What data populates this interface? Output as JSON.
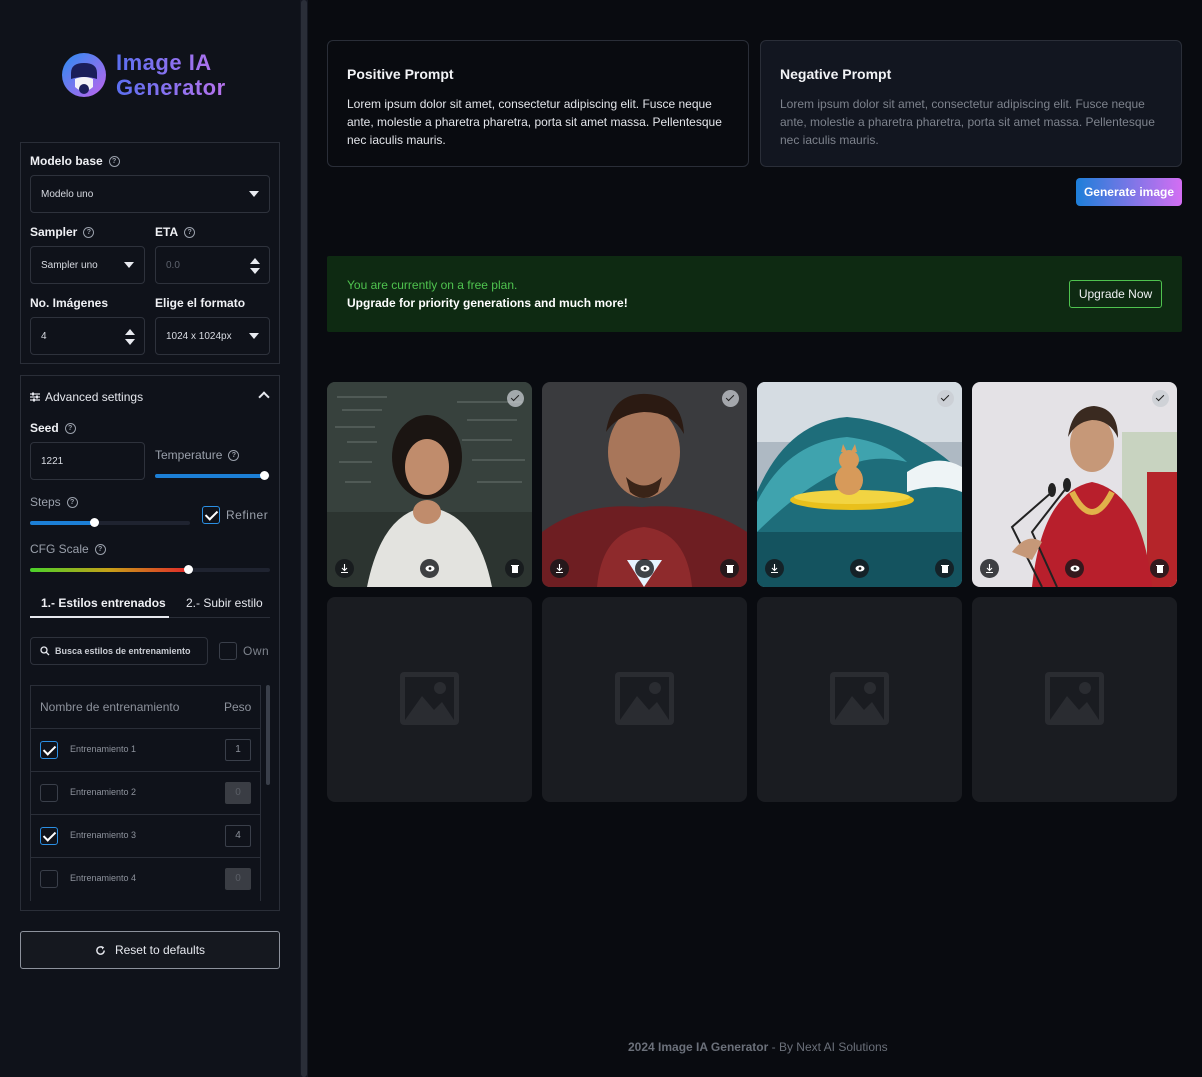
{
  "app": {
    "logo_line1": "Image IA",
    "logo_line2": "Generator"
  },
  "settings": {
    "base_model_label": "Modelo base",
    "base_model_value": "Modelo uno",
    "sampler_label": "Sampler",
    "sampler_value": "Sampler uno",
    "eta_label": "ETA",
    "eta_placeholder": "0.0",
    "num_images_label": "No. Imágenes",
    "num_images_value": "4",
    "format_label": "Elige el formato",
    "format_value": "1024 x 1024px"
  },
  "advanced": {
    "title": "Advanced settings",
    "seed_label": "Seed",
    "seed_value": "1221",
    "temperature_label": "Temperature",
    "temperature_level": 0.95,
    "steps_label": "Steps",
    "steps_level": 0.4,
    "refiner_label": "Refiner",
    "refiner_checked": true,
    "cfg_label": "CFG Scale",
    "cfg_level": 0.66
  },
  "styles": {
    "tab_trained": "1.- Estilos entrenados",
    "tab_upload": "2.- Subir estilo",
    "search_placeholder": "Busca estilos de entrenamiento",
    "own_label": "Own",
    "col_name": "Nombre de entrenamiento",
    "col_weight": "Peso",
    "rows": [
      {
        "name": "Entrenamiento 1",
        "weight": "1",
        "checked": true
      },
      {
        "name": "Entrenamiento 2",
        "weight": "0",
        "checked": false
      },
      {
        "name": "Entrenamiento 3",
        "weight": "4",
        "checked": true
      },
      {
        "name": "Entrenamiento 4",
        "weight": "0",
        "checked": false
      }
    ]
  },
  "reset_label": "Reset to defaults",
  "prompts": {
    "positive_title": "Positive Prompt",
    "positive_text": "Lorem ipsum dolor sit amet, consectetur adipiscing elit. Fusce neque ante, molestie a pharetra pharetra, porta sit amet massa. Pellentesque nec iaculis mauris.",
    "negative_title": "Negative Prompt",
    "negative_text": "Lorem ipsum dolor sit amet, consectetur adipiscing elit. Fusce neque ante, molestie a pharetra pharetra, porta sit amet massa. Pellentesque nec iaculis mauris."
  },
  "generate_label": "Generate image",
  "banner": {
    "line1": "You are currently on a free plan.",
    "line2": "Upgrade for priority generations and much more!",
    "button": "Upgrade Now"
  },
  "gallery": [
    {
      "subject": "woman at chalkboard",
      "selected": true
    },
    {
      "subject": "man in red armor suit",
      "selected": true
    },
    {
      "subject": "cat surfing a wave",
      "selected": true
    },
    {
      "subject": "woman speaking at podium",
      "selected": true
    }
  ],
  "footer": {
    "brand": "2024 Image IA Generator",
    "suffix": " - By Next AI Solutions"
  },
  "colors": {
    "accent_blue": "#1c7fd6",
    "banner_green": "#4fc34f",
    "gradient_end": "#d46ef3"
  }
}
